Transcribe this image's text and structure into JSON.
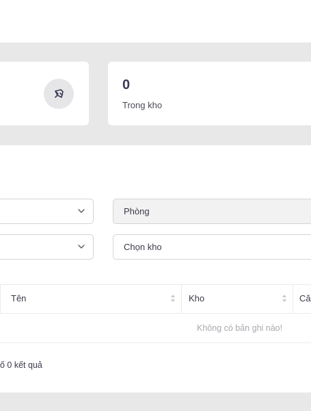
{
  "stats": {
    "stock_value": "0",
    "stock_label": "Trong kho"
  },
  "filters": {
    "room_placeholder": "Phòng",
    "warehouse_placeholder": "Chọn kho"
  },
  "table": {
    "columns": [
      "Tên",
      "Kho",
      "Că"
    ],
    "empty_message": "Không có bản ghi nào!"
  },
  "footer": {
    "result_text": "ố 0 kết quả"
  },
  "icons": {
    "card_icon": "pen-nib-icon"
  }
}
